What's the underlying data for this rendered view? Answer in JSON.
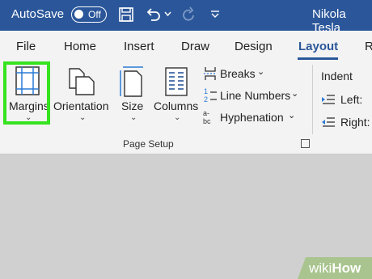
{
  "titlebar": {
    "autosave_label": "AutoSave",
    "autosave_state": "Off",
    "user_name": "Nikola Tesla",
    "bg_color": "#2b579a"
  },
  "tabs": [
    "File",
    "Home",
    "Insert",
    "Draw",
    "Design",
    "Layout",
    "R"
  ],
  "active_tab": "Layout",
  "ribbon": {
    "margins": "Margins",
    "orientation": "Orientation",
    "size": "Size",
    "columns": "Columns",
    "breaks": "Breaks",
    "line_numbers": "Line Numbers",
    "hyphenation": "Hyphenation",
    "group_label": "Page Setup",
    "indent": "Indent",
    "left": "Left:",
    "right": "Right:",
    "highlight_color": "#35e31f"
  },
  "watermark": {
    "prefix": "wiki",
    "suffix": "How"
  }
}
